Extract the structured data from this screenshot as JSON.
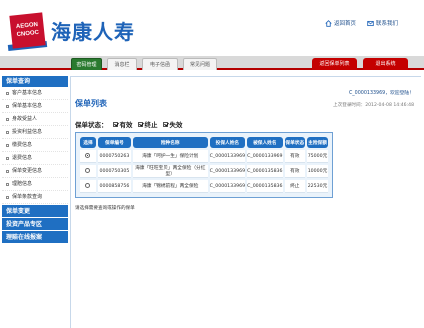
{
  "header": {
    "logo_top": "AEGON",
    "logo_bottom": "CNOOC",
    "brand_name": "海康人寿",
    "links": [
      {
        "icon": "house-icon",
        "label": "返回首页"
      },
      {
        "icon": "mail-icon",
        "label": "联系我们"
      }
    ]
  },
  "tabs": [
    {
      "label": "密码管理",
      "active": true
    },
    {
      "label": "消息栏",
      "active": false
    },
    {
      "label": "电子信函",
      "active": false
    },
    {
      "label": "常见问题",
      "active": false
    }
  ],
  "actions": {
    "back_to_list": "返回保单列表",
    "logout": "退出系统"
  },
  "sidebar": {
    "section1": "保单查询",
    "items": [
      "客户基本信息",
      "保单基本信息",
      "身故受益人",
      "投资利益信息",
      "缴费信息",
      "退费信息",
      "保单变更信息",
      "理赔信息",
      "保单条款查询"
    ],
    "categories": [
      "保单变更",
      "投资产品专区",
      "理赔在线报案"
    ]
  },
  "main": {
    "welcome": "C_0000133969，欢迎登陆！",
    "last_login": "上次登录时间：2012-04-08 14:46:48",
    "title": "保单列表",
    "filter_label": "保单状态：",
    "filters": [
      "有效",
      "终止",
      "失效"
    ],
    "columns": [
      "选择",
      "保单编号",
      "险种名称",
      "投保人姓名",
      "被保人姓名",
      "保单状态",
      "主险保额"
    ],
    "rows": [
      {
        "selected": true,
        "no": "0000750263",
        "product": "海康「呵护一生」保险计划",
        "applicant": "C_0000133969",
        "insured": "C_0000133969",
        "status": "有效",
        "amount": "75000元"
      },
      {
        "selected": false,
        "no": "0000750305",
        "product": "海康「旺旺宝贝」两全保险（分红型）",
        "applicant": "C_0000133969",
        "insured": "C_0000135836",
        "status": "有效",
        "amount": "10000元"
      },
      {
        "selected": false,
        "no": "0000858756",
        "product": "海康「锦绣前程」两全保险",
        "applicant": "C_0000133969",
        "insured": "C_0000135836",
        "status": "终止",
        "amount": "22530元"
      }
    ],
    "hint": "请选择需要查询或操作的保单"
  }
}
